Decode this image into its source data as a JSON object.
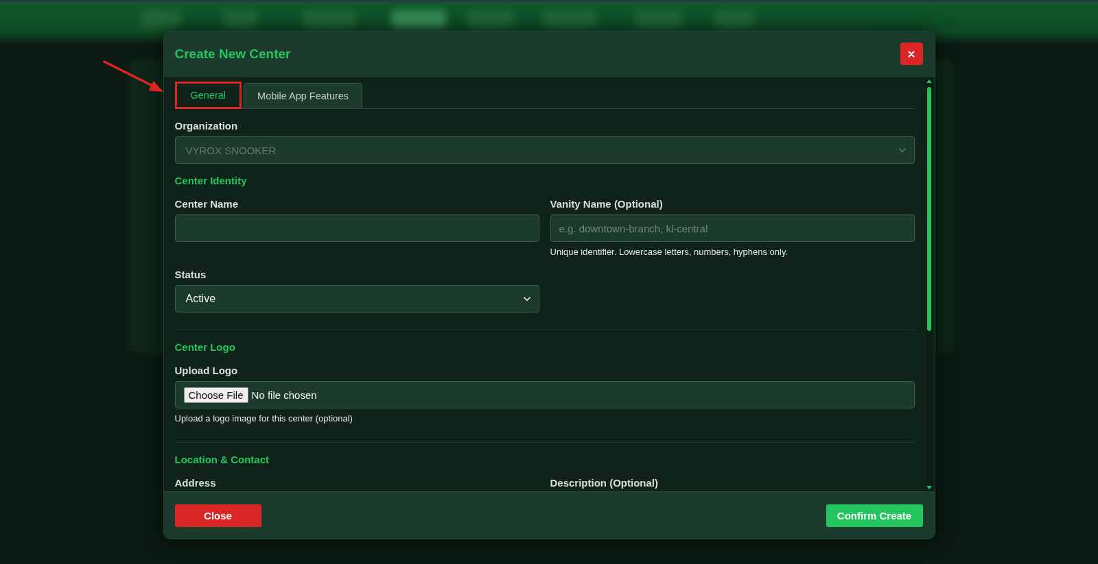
{
  "modal": {
    "title": "Create New Center"
  },
  "tabs": [
    {
      "label": "General",
      "selected": true,
      "highlighted": true
    },
    {
      "label": "Mobile App Features",
      "selected": false,
      "highlighted": false
    }
  ],
  "form": [
    {
      "kind": "field",
      "label": "Organization",
      "input": {
        "kind": "select",
        "value": "VYROX SNOOKER",
        "disabled": true
      }
    },
    {
      "kind": "heading",
      "text": "Center Identity"
    },
    {
      "kind": "pair",
      "fields": [
        {
          "label": "Center Name",
          "input": {
            "kind": "text"
          }
        },
        {
          "label": "Vanity Name (Optional)",
          "input": {
            "kind": "text",
            "placeholder": "e.g. downtown-branch, kl-central"
          },
          "hint": "Unique identifier. Lowercase letters, numbers, hyphens only."
        }
      ]
    },
    {
      "kind": "pair",
      "fields": [
        {
          "label": "Status",
          "input": {
            "kind": "select",
            "value": "Active",
            "disabled": false
          }
        }
      ]
    },
    {
      "kind": "divider"
    },
    {
      "kind": "heading",
      "text": "Center Logo"
    },
    {
      "kind": "field",
      "label": "Upload Logo",
      "input": {
        "kind": "file",
        "button": "Choose File",
        "value": "No file chosen"
      },
      "hint": "Upload a logo image for this center (optional)"
    },
    {
      "kind": "divider"
    },
    {
      "kind": "heading",
      "text": "Location & Contact"
    },
    {
      "kind": "pair",
      "fields": [
        {
          "label": "Address"
        },
        {
          "label": "Description (Optional)"
        }
      ]
    }
  ],
  "footer": {
    "buttons": [
      {
        "label": "Close",
        "kind": "danger"
      },
      {
        "label": "Confirm Create",
        "kind": "primary"
      }
    ]
  }
}
